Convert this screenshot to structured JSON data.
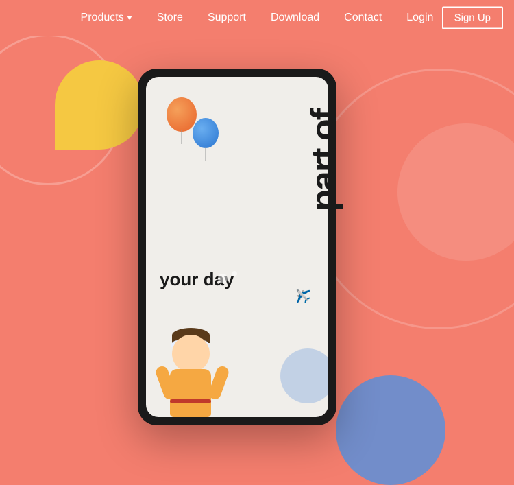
{
  "nav": {
    "products_label": "Products",
    "store_label": "Store",
    "support_label": "Support",
    "download_label": "Download",
    "contact_label": "Contact",
    "login_label": "Login",
    "signup_label": "Sign Up"
  },
  "hero": {
    "vertical_text": "part of",
    "your_day_text": "your day",
    "colors": {
      "bg": "#F47E6E",
      "yellow": "#F5C842",
      "blue_circle": "#5B8FDB"
    }
  }
}
